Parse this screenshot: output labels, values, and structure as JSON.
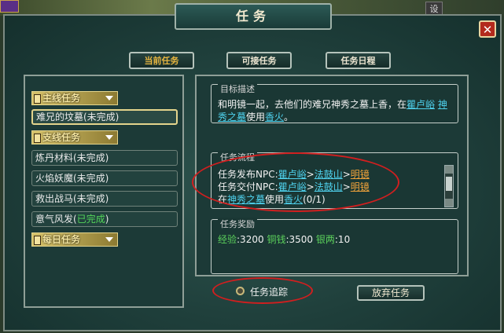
{
  "window": {
    "title": "任务",
    "close_label": "✕",
    "corner_tag": "设"
  },
  "tabs": [
    {
      "label": "当前任务",
      "active": true
    },
    {
      "label": "可接任务",
      "active": false
    },
    {
      "label": "任务日程",
      "active": false
    }
  ],
  "quest_list": {
    "categories": [
      {
        "label": "主线任务"
      },
      {
        "label": "支线任务"
      },
      {
        "label": "每日任务"
      }
    ],
    "quests": [
      {
        "label": "难兄的坟墓(未完成)",
        "selected": true
      },
      {
        "label": "炼丹材料(未完成)"
      },
      {
        "label": "火焰妖魔(未完成)"
      },
      {
        "label": "救出战马(未完成)"
      },
      {
        "prefix": "意气风发(",
        "status": "已完成",
        "suffix": ")"
      }
    ]
  },
  "objective": {
    "header": "目标描述",
    "text_1": "和明镜一起，去他们的难兄神秀之墓上香，在",
    "link_1": "瞿卢峪",
    "link_2": "神",
    "text_2": "秀之墓",
    "text_3": "使用",
    "item": "香火",
    "end": "。"
  },
  "process": {
    "header": "任务流程",
    "issue_label": "任务发布NPC:",
    "submit_label": "任务交付NPC:",
    "place": "瞿卢峪",
    "sep": ">",
    "mountain": "法鼓山",
    "npc": "明镜",
    "at": "在",
    "tomb": "神秀之墓",
    "use": "使用",
    "item": "香火",
    "count": "(0/1)"
  },
  "reward": {
    "header": "任务奖励",
    "exp_label": "经验",
    "exp_value": ":3200",
    "copper_label": "铜钱",
    "copper_value": ":3500",
    "silver_label": "银两",
    "silver_value": ":10"
  },
  "footer": {
    "track_label": "任务追踪",
    "abandon_label": "放弃任务"
  },
  "colors": {
    "link": "#4fd2ee",
    "npc": "#f0a23a",
    "complete": "#53d65a",
    "annotation": "#d01f1f"
  }
}
